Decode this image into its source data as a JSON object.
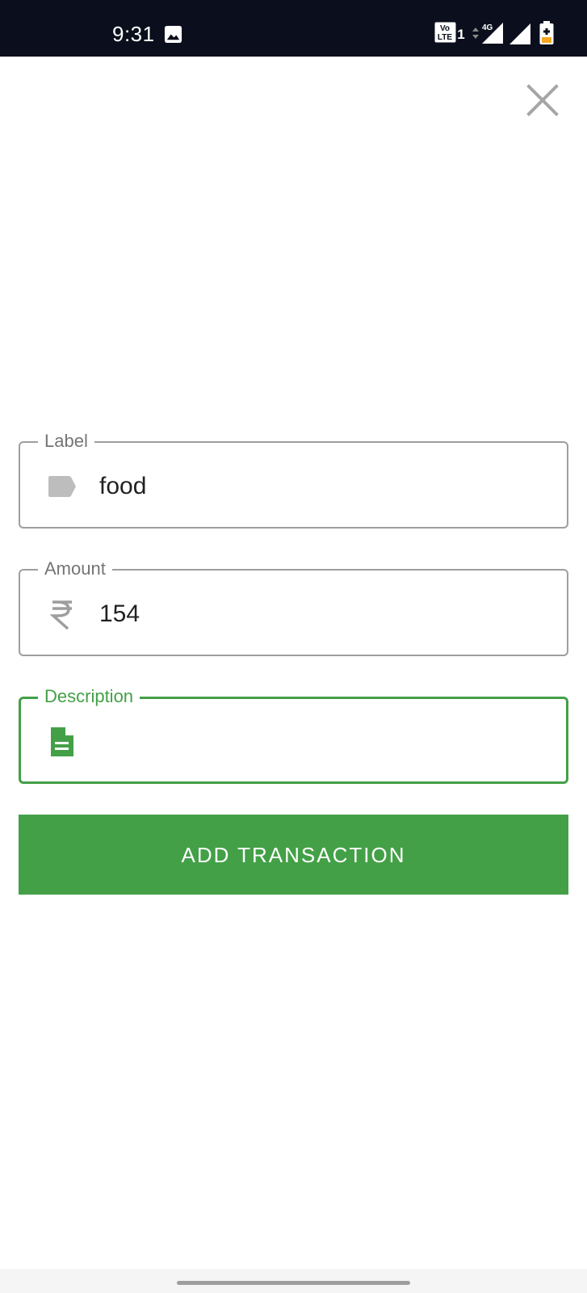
{
  "status_bar": {
    "time": "9:31",
    "icons": [
      "gallery-icon",
      "volte-icon",
      "data-4g-icon",
      "signal-icon",
      "battery-icon"
    ],
    "volte_text_top": "Vo",
    "volte_text_bottom": "LTE",
    "sim_number": "1",
    "network_type": "4G"
  },
  "form": {
    "label_field": {
      "label": "Label",
      "value": "food",
      "icon": "tag-icon"
    },
    "amount_field": {
      "label": "Amount",
      "value": "154",
      "icon": "rupee-icon"
    },
    "description_field": {
      "label": "Description",
      "value": "",
      "icon": "document-icon",
      "focused": true
    },
    "submit_label": "ADD TRANSACTION"
  },
  "colors": {
    "accent": "#43a047",
    "status_bar_bg": "#0b0e1c",
    "border": "#9e9e9e",
    "label_text": "#757575",
    "icon_gray": "#bdbdbd"
  }
}
